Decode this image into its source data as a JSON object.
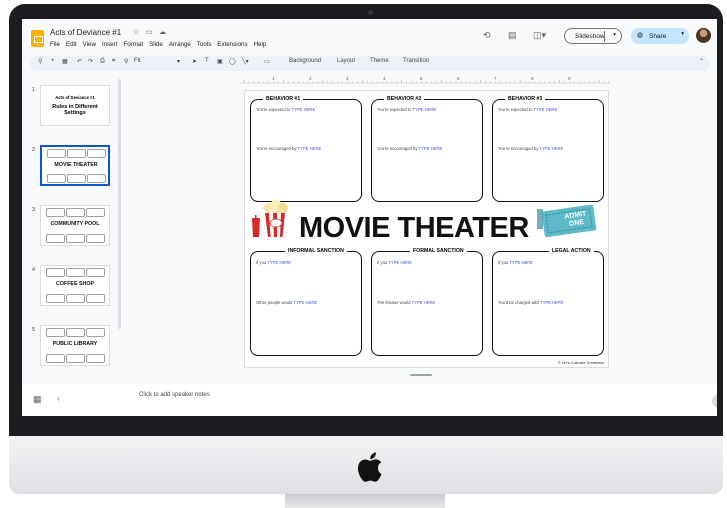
{
  "app": {
    "doc_title": "Acts of Deviance #1",
    "menu": [
      "File",
      "Edit",
      "View",
      "Insert",
      "Format",
      "Slide",
      "Arrange",
      "Tools",
      "Extensions",
      "Help"
    ],
    "slideshow_label": "Slideshow",
    "share_label": "Share",
    "toolbar": {
      "zoom": "Fit",
      "background": "Background",
      "layout": "Layout",
      "theme": "Theme",
      "transition": "Transition"
    },
    "ruler_ticks": [
      "1",
      "2",
      "3",
      "4",
      "5",
      "6",
      "7",
      "8",
      "9"
    ],
    "notes_placeholder": "Click to add speaker notes",
    "accent": "#0b57d0",
    "share_bg": "#c2e7ff"
  },
  "filmstrip": {
    "slides": [
      {
        "num": "1",
        "subtitle": "Acts of Deviance #1",
        "title": "Rules in Different Settings"
      },
      {
        "num": "2",
        "label": "MOVIE THEATER"
      },
      {
        "num": "3",
        "label": "COMMUNITY POOL"
      },
      {
        "num": "4",
        "label": "COFFEE SHOP"
      },
      {
        "num": "5",
        "label": "PUBLIC LIBRARY"
      }
    ]
  },
  "slide": {
    "title": "MOVIE THEATER",
    "ticket_text": "ADMIT ONE",
    "top_boxes": [
      {
        "heading": "BEHAVIOR #1",
        "line1": "You're expected to ",
        "line2": "You're encouraged by "
      },
      {
        "heading": "BEHAVIOR #2",
        "line1": "You're expected to ",
        "line2": "You're encouraged by "
      },
      {
        "heading": "BEHAVIOR #3",
        "line1": "You're expected to ",
        "line2": "You're encouraged by "
      }
    ],
    "bottom_boxes": [
      {
        "heading": "INFORMAL SANCTION",
        "line1": "If you ",
        "line2": "Other people would "
      },
      {
        "heading": "FORMAL SANCTION",
        "line1": "If you ",
        "line2": "The theater would "
      },
      {
        "heading": "LEGAL ACTION",
        "line1": "If you ",
        "line2": "You'd be charged with "
      }
    ],
    "placeholder": "TYPE HERE",
    "copyright": "© Let's Cultivate Greatness"
  }
}
